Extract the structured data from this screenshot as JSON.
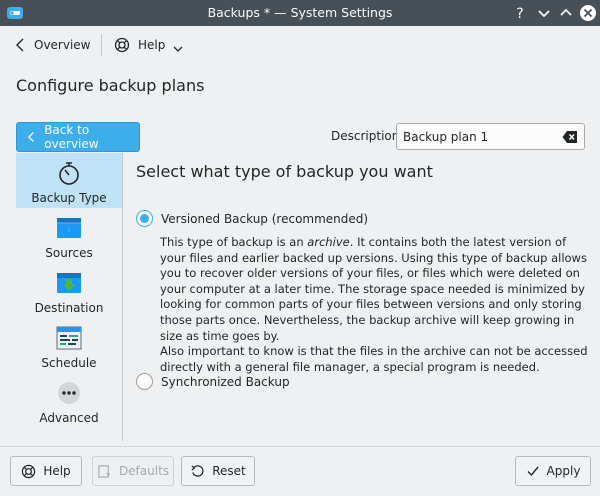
{
  "window": {
    "title": "Backups * — System Settings",
    "accent": "#3daee9",
    "titlebar_color": "#475057"
  },
  "toolbar": {
    "overview_label": "Overview",
    "help_label": "Help"
  },
  "page": {
    "title": "Configure backup plans"
  },
  "back_button": {
    "label": "Back to overview"
  },
  "description": {
    "label": "Description:",
    "value": "Backup plan 1"
  },
  "sidebar": {
    "items": [
      {
        "label": "Backup Type",
        "icon": "stopwatch-icon",
        "active": true
      },
      {
        "label": "Sources",
        "icon": "folder-icon",
        "active": false
      },
      {
        "label": "Destination",
        "icon": "folder-download-icon",
        "active": false
      },
      {
        "label": "Schedule",
        "icon": "calendar-icon",
        "active": false
      },
      {
        "label": "Advanced",
        "icon": "more-icon",
        "active": false
      }
    ]
  },
  "main": {
    "heading": "Select what type of backup you want",
    "options": [
      {
        "label": "Versioned Backup (recommended)",
        "selected": true
      },
      {
        "label": "Synchronized Backup",
        "selected": false
      }
    ],
    "versioned_description": {
      "part1": "This type of backup is an ",
      "emphasis": "archive",
      "part2": ". It contains both the latest version of your files and earlier backed up versions. Using this type of backup allows you to recover older versions of your files, or files which were deleted on your computer at a later time. The storage space needed is minimized by looking for common parts of your files between versions and only storing those parts once. Nevertheless, the backup archive will keep growing in size as time goes by.",
      "part3": "Also important to know is that the files in the archive can not be accessed directly with a general file manager, a special program is needed."
    }
  },
  "footer": {
    "help_label": "Help",
    "defaults_label": "Defaults",
    "reset_label": "Reset",
    "apply_label": "Apply"
  }
}
